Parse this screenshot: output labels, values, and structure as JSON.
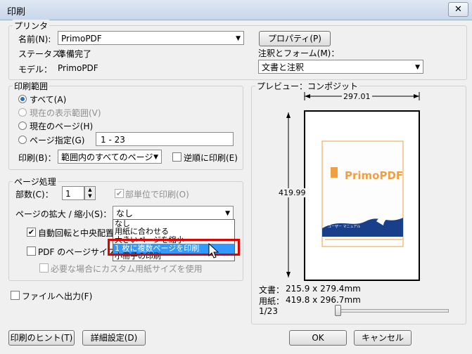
{
  "window": {
    "title": "印刷",
    "close": "✕"
  },
  "printer": {
    "group_label": "プリンタ",
    "name_label": "名前(N):",
    "name_value": "PrimoPDF",
    "properties_button": "プロパティ(P)",
    "status_label": "ステータス：",
    "status_value": "準備完了",
    "model_label": "モデル：",
    "model_value": "PrimoPDF",
    "annotations_label": "注釈とフォーム(M)：",
    "annotations_value": "文書と注釈"
  },
  "range": {
    "group_label": "印刷範囲",
    "all": "すべて(A)",
    "current_view": "現在の表示範囲(V)",
    "current_page": "現在のページ(H)",
    "pages": "ページ指定(G)",
    "pages_value": "1 - 23",
    "print_label": "印刷(B)：",
    "print_value": "範囲内のすべてのページ",
    "reverse": "逆順に印刷(E)"
  },
  "handling": {
    "group_label": "ページ処理",
    "copies_label": "部数(C)：",
    "copies_value": "1",
    "collate": "部単位で印刷(O)",
    "scaling_label": "ページの拡大 / 縮小(S)：",
    "scaling_value": "なし",
    "auto_rotate": "自動回転と中央配置(",
    "pdf_paper": "PDF のページサイズ(",
    "custom_paper": "必要な場合にカスタム用紙サイズを使用",
    "dropdown_options": [
      "なし",
      "用紙に合わせる",
      "大きいページを縮小",
      "1 枚に複数ページを印刷",
      "小冊子の印刷"
    ],
    "dropdown_selected_index": 3
  },
  "print_to_file": "ファイルへ出力(F)",
  "preview": {
    "group_label": "プレビュー：コンポジット",
    "width_dim": "297.01",
    "height_dim": "419.99",
    "logo": "PrimoPDF",
    "cover_line1": "バージョン4.1",
    "cover_line2": "ユーザー マニュアル",
    "document_label": "文書：",
    "document_size": "215.9 x 279.4mm",
    "paper_label": "用紙：",
    "paper_size": "419.8 x 296.7mm",
    "page_count": "1/23",
    "slider_value": 0.0
  },
  "buttons": {
    "hints": "印刷のヒント(T)",
    "advanced": "詳細設定(D)",
    "ok": "OK",
    "cancel": "キャンセル"
  },
  "colors": {
    "selection": "#3399ff",
    "highlight_box": "#e00000",
    "logo_orange": "#f0a040",
    "wave_blue": "#1a3f8a"
  }
}
